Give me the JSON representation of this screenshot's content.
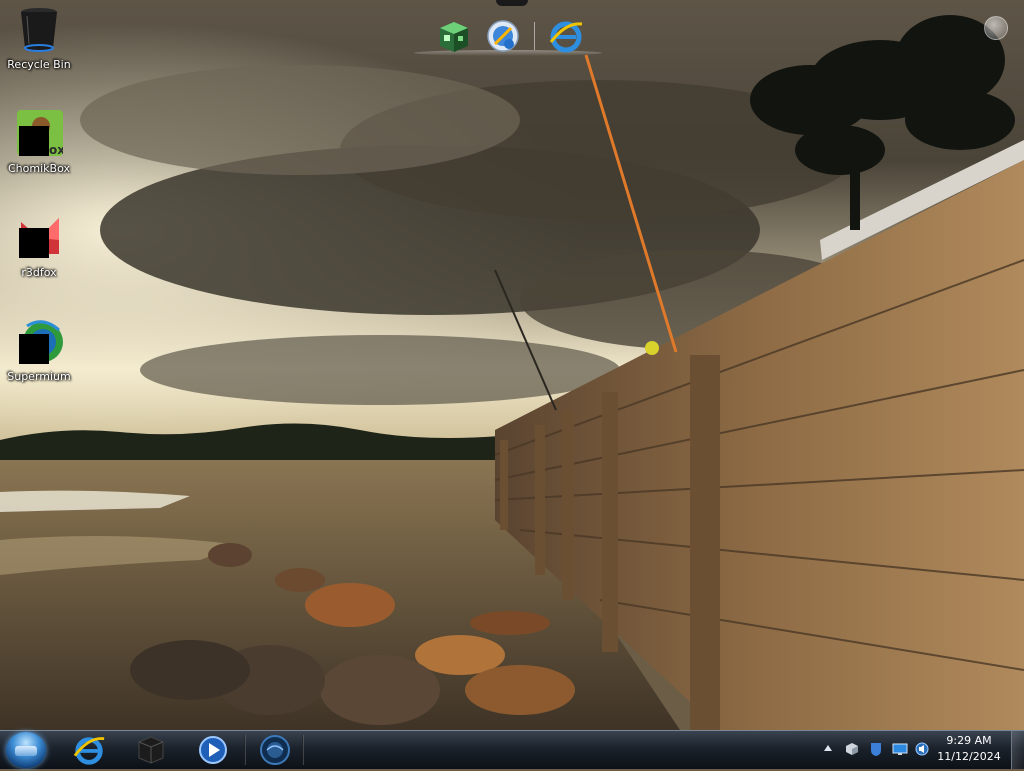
{
  "desktop": {
    "icons": [
      {
        "label": "Recycle Bin",
        "icon": "recycle-bin-icon"
      },
      {
        "label": "ChomikBox",
        "icon": "chomikbox-icon"
      },
      {
        "label": "r3dfox",
        "icon": "r3dfox-icon"
      },
      {
        "label": "Supermium",
        "icon": "supermium-icon"
      }
    ]
  },
  "dock": {
    "items": [
      {
        "name": "cube-app-icon"
      },
      {
        "name": "browser-globe-icon"
      },
      {
        "name": "internet-explorer-icon"
      }
    ]
  },
  "taskbar": {
    "start": "start-orb",
    "pinned": [
      {
        "name": "internet-explorer-icon"
      },
      {
        "name": "black-cube-icon"
      },
      {
        "name": "media-player-icon"
      },
      {
        "name": "globe-app-icon"
      }
    ],
    "tray": {
      "icons": [
        "network-cube-icon",
        "shield-icon",
        "monitor-icon",
        "volume-icon"
      ]
    },
    "clock": {
      "time": "9:29 AM",
      "date": "11/12/2024"
    }
  },
  "colors": {
    "taskbar": "#1b222b",
    "sky": "#a89c84",
    "wood": "#8a6a45"
  }
}
